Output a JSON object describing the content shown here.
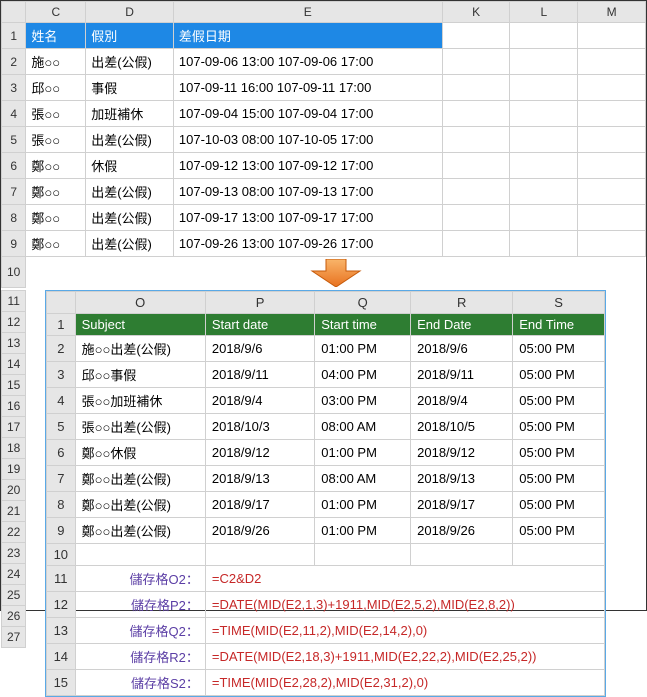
{
  "top": {
    "cols": [
      "C",
      "D",
      "E",
      "K",
      "L",
      "M"
    ],
    "header": [
      "姓名",
      "假別",
      "差假日期"
    ],
    "rows": [
      {
        "rn": "2",
        "c": "施○○",
        "d": "出差(公假)",
        "e": "107-09-06 13:00  107-09-06 17:00"
      },
      {
        "rn": "3",
        "c": "邱○○",
        "d": "事假",
        "e": "107-09-11 16:00  107-09-11 17:00"
      },
      {
        "rn": "4",
        "c": "張○○",
        "d": "加班補休",
        "e": "107-09-04 15:00  107-09-04 17:00"
      },
      {
        "rn": "5",
        "c": "張○○",
        "d": "出差(公假)",
        "e": "107-10-03 08:00  107-10-05 17:00"
      },
      {
        "rn": "6",
        "c": "鄭○○",
        "d": "休假",
        "e": "107-09-12 13:00  107-09-12 17:00"
      },
      {
        "rn": "7",
        "c": "鄭○○",
        "d": "出差(公假)",
        "e": "107-09-13 08:00  107-09-13 17:00"
      },
      {
        "rn": "8",
        "c": "鄭○○",
        "d": "出差(公假)",
        "e": "107-09-17 13:00  107-09-17 17:00"
      },
      {
        "rn": "9",
        "c": "鄭○○",
        "d": "出差(公假)",
        "e": "107-09-26 13:00  107-09-26 17:00"
      }
    ]
  },
  "left_blank_rows": [
    "10",
    "11",
    "12",
    "13",
    "14",
    "15",
    "16",
    "17",
    "18",
    "19",
    "20",
    "21",
    "22",
    "23",
    "24",
    "25",
    "26",
    "27"
  ],
  "inner": {
    "cols": [
      "O",
      "P",
      "Q",
      "R",
      "S"
    ],
    "header": [
      "Subject",
      "Start date",
      "Start time",
      "End Date",
      "End Time"
    ],
    "rows": [
      {
        "rn": "2",
        "o": "施○○出差(公假)",
        "p": "2018/9/6",
        "q": "01:00 PM",
        "r": "2018/9/6",
        "s": "05:00 PM"
      },
      {
        "rn": "3",
        "o": "邱○○事假",
        "p": "2018/9/11",
        "q": "04:00 PM",
        "r": "2018/9/11",
        "s": "05:00 PM"
      },
      {
        "rn": "4",
        "o": "張○○加班補休",
        "p": "2018/9/4",
        "q": "03:00 PM",
        "r": "2018/9/4",
        "s": "05:00 PM"
      },
      {
        "rn": "5",
        "o": "張○○出差(公假)",
        "p": "2018/10/3",
        "q": "08:00 AM",
        "r": "2018/10/5",
        "s": "05:00 PM"
      },
      {
        "rn": "6",
        "o": "鄭○○休假",
        "p": "2018/9/12",
        "q": "01:00 PM",
        "r": "2018/9/12",
        "s": "05:00 PM"
      },
      {
        "rn": "7",
        "o": "鄭○○出差(公假)",
        "p": "2018/9/13",
        "q": "08:00 AM",
        "r": "2018/9/13",
        "s": "05:00 PM"
      },
      {
        "rn": "8",
        "o": "鄭○○出差(公假)",
        "p": "2018/9/17",
        "q": "01:00 PM",
        "r": "2018/9/17",
        "s": "05:00 PM"
      },
      {
        "rn": "9",
        "o": "鄭○○出差(公假)",
        "p": "2018/9/26",
        "q": "01:00 PM",
        "r": "2018/9/26",
        "s": "05:00 PM"
      }
    ],
    "formulas": [
      {
        "rn": "11",
        "label": "儲存格O2：",
        "val": "=C2&D2"
      },
      {
        "rn": "12",
        "label": "儲存格P2：",
        "val": "=DATE(MID(E2,1,3)+1911,MID(E2,5,2),MID(E2,8,2))"
      },
      {
        "rn": "13",
        "label": "儲存格Q2：",
        "val": "=TIME(MID(E2,11,2),MID(E2,14,2),0)"
      },
      {
        "rn": "14",
        "label": "儲存格R2：",
        "val": "=DATE(MID(E2,18,3)+1911,MID(E2,22,2),MID(E2,25,2))"
      },
      {
        "rn": "15",
        "label": "儲存格S2：",
        "val": "=TIME(MID(E2,28,2),MID(E2,31,2),0)"
      }
    ]
  }
}
